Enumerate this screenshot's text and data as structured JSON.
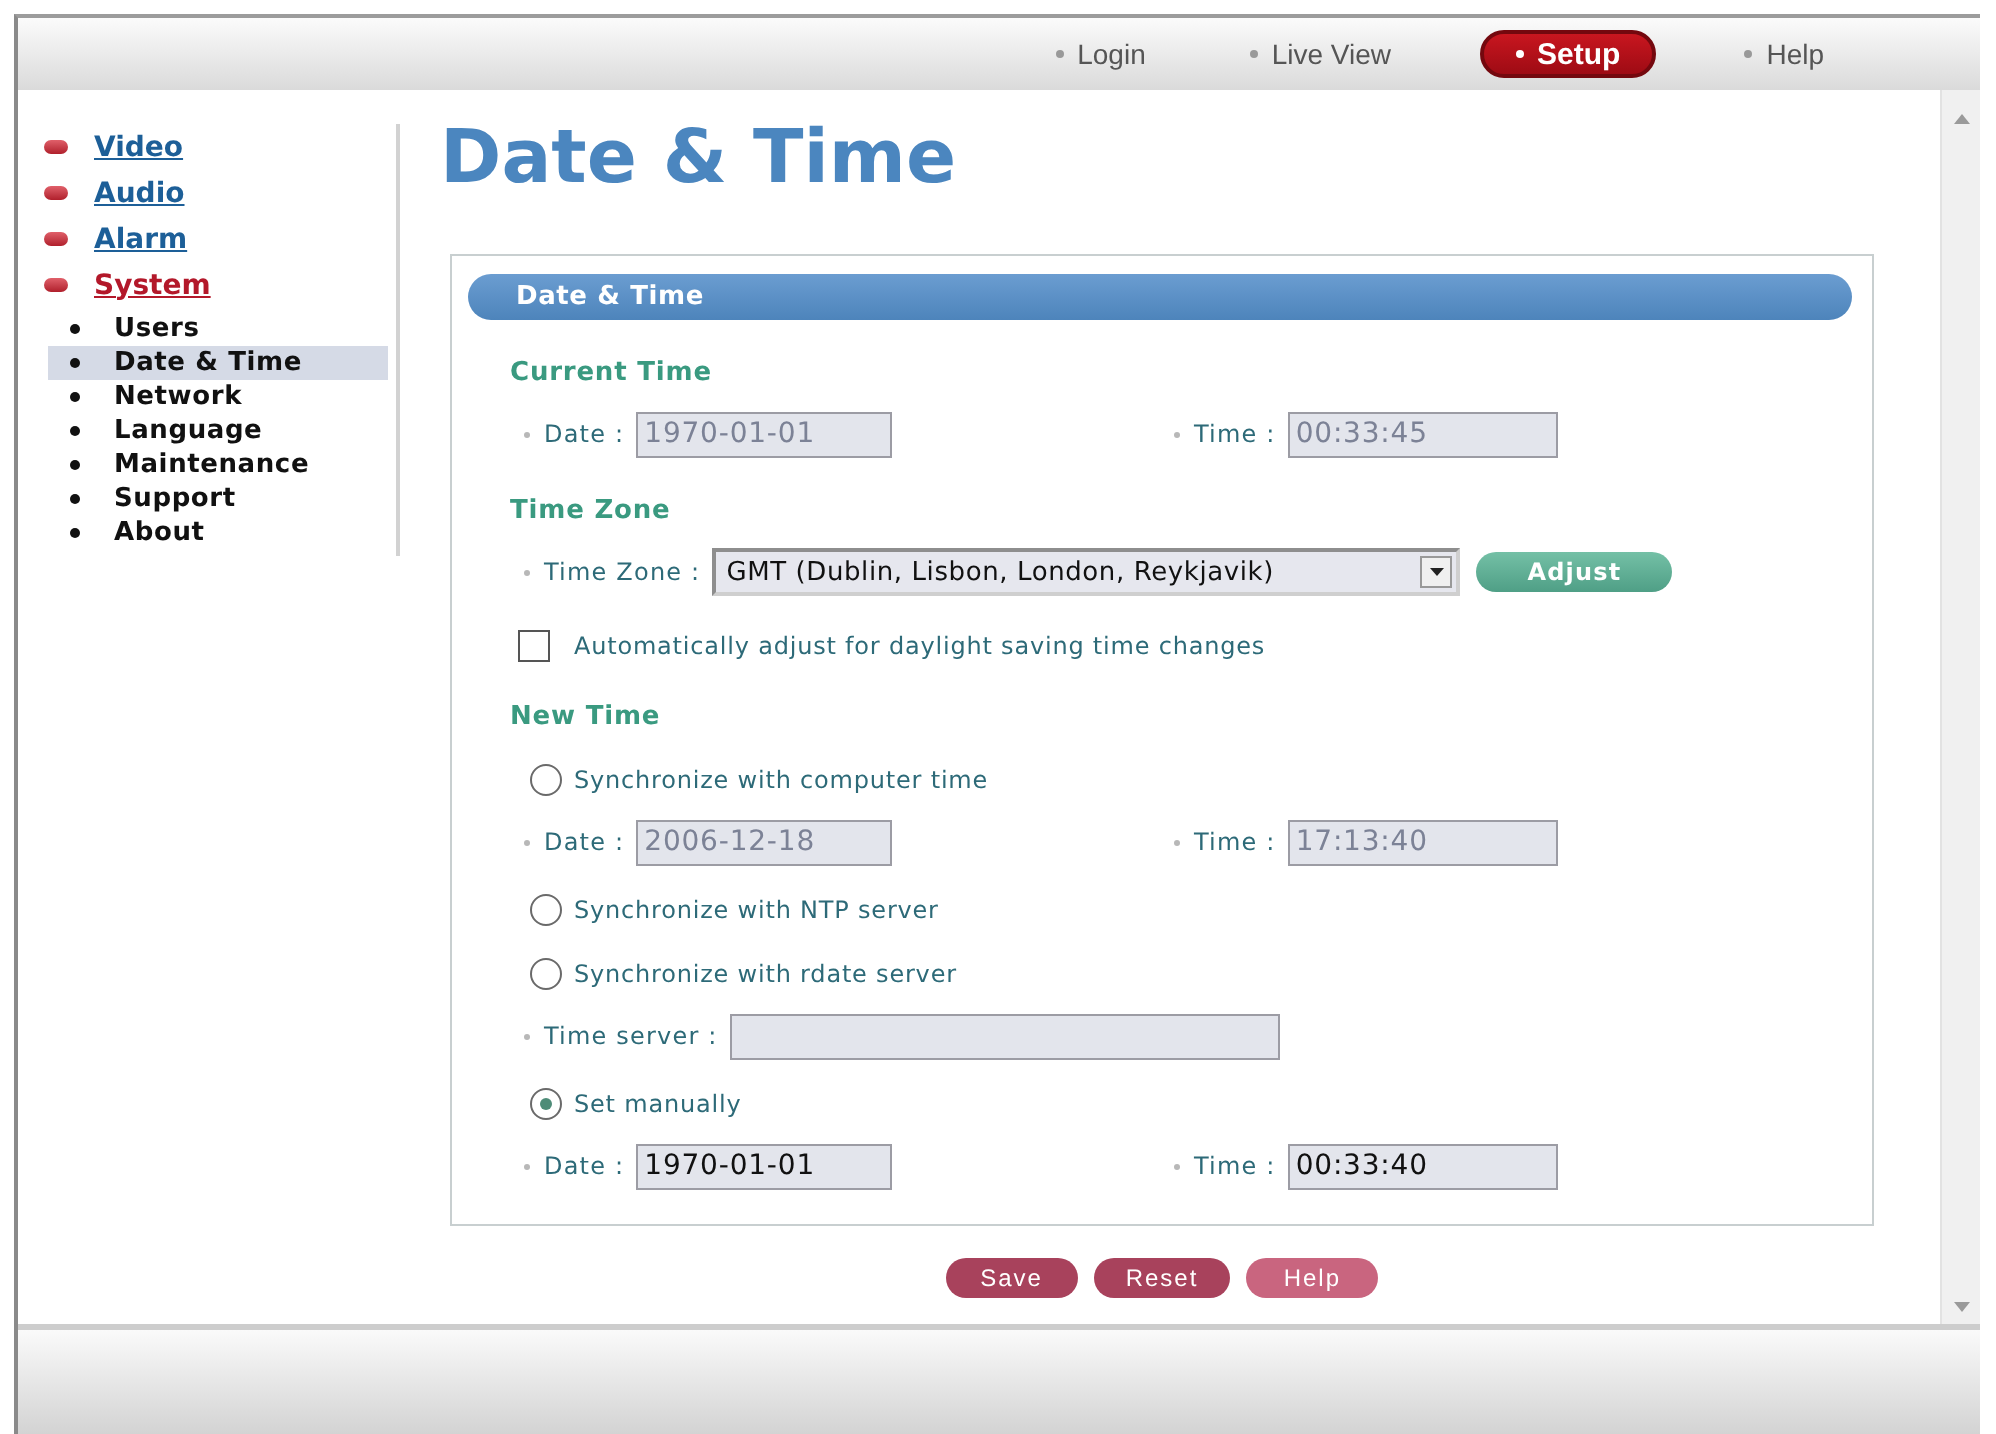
{
  "top_nav": [
    {
      "label": "Login",
      "selected": false
    },
    {
      "label": "Live View",
      "selected": false
    },
    {
      "label": "Setup",
      "selected": true
    },
    {
      "label": "Help",
      "selected": false
    }
  ],
  "sidebar": {
    "items": [
      {
        "label": "Video",
        "selected": false
      },
      {
        "label": "Audio",
        "selected": false
      },
      {
        "label": "Alarm",
        "selected": false
      },
      {
        "label": "System",
        "selected": true,
        "children": [
          {
            "label": "Users",
            "selected": false
          },
          {
            "label": "Date & Time",
            "selected": true
          },
          {
            "label": "Network",
            "selected": false
          },
          {
            "label": "Language",
            "selected": false
          },
          {
            "label": "Maintenance",
            "selected": false
          },
          {
            "label": "Support",
            "selected": false
          },
          {
            "label": "About",
            "selected": false
          }
        ]
      }
    ]
  },
  "page_title": "Date & Time",
  "panel": {
    "title": "Date & Time",
    "rows": [
      {
        "kind": "heading",
        "text": "Current Time"
      },
      {
        "kind": "field_pair",
        "fields": [
          {
            "label": "Date :",
            "value": "1970-01-01",
            "disabled": true
          },
          {
            "label": "Time :",
            "value": "00:33:45",
            "disabled": true
          }
        ]
      },
      {
        "kind": "heading",
        "text": "Time Zone"
      },
      {
        "kind": "select",
        "label": "Time Zone :",
        "value": "GMT (Dublin, Lisbon, London, Reykjavik)",
        "button": "Adjust"
      },
      {
        "kind": "checkbox",
        "label": "Automatically adjust for daylight saving time changes",
        "checked": false
      },
      {
        "kind": "heading",
        "text": "New Time"
      },
      {
        "kind": "radio",
        "label": "Synchronize with computer time",
        "selected": false
      },
      {
        "kind": "field_pair",
        "fields": [
          {
            "label": "Date :",
            "value": "2006-12-18",
            "disabled": true
          },
          {
            "label": "Time :",
            "value": "17:13:40",
            "disabled": true
          }
        ]
      },
      {
        "kind": "radio",
        "label": "Synchronize with NTP server",
        "selected": false
      },
      {
        "kind": "radio",
        "label": "Synchronize with rdate server",
        "selected": false
      },
      {
        "kind": "text_field",
        "label": "Time server :"
      },
      {
        "kind": "radio",
        "label": "Set manually",
        "selected": true
      },
      {
        "kind": "field_pair",
        "fields": [
          {
            "label": "Date :",
            "value": "1970-01-01",
            "disabled": false
          },
          {
            "label": "Time :",
            "value": "00:33:40",
            "disabled": false
          }
        ]
      }
    ]
  },
  "buttons": [
    {
      "label": "Save",
      "kind": "action"
    },
    {
      "label": "Reset",
      "kind": "action"
    },
    {
      "label": "Help",
      "kind": "help"
    }
  ]
}
